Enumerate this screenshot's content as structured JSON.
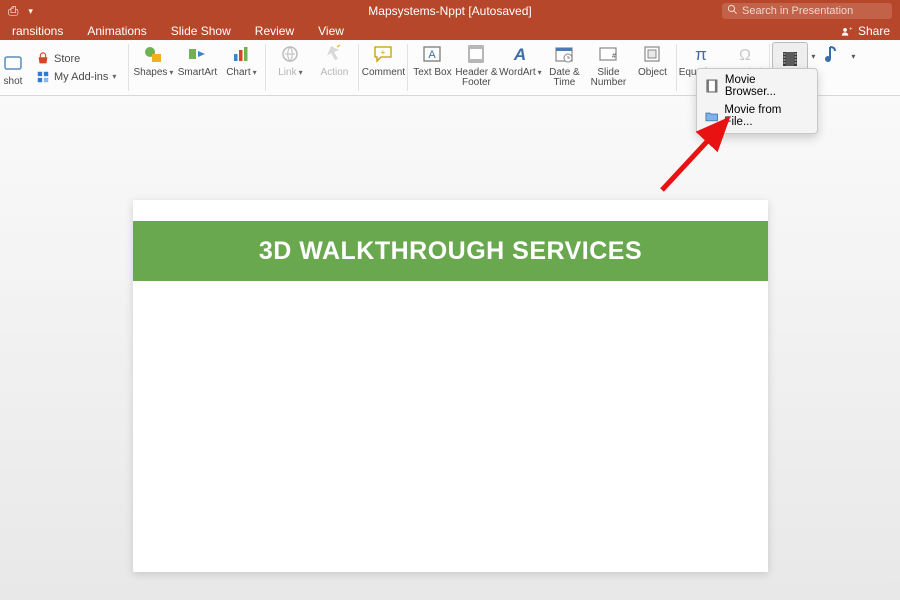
{
  "title": "Mapsystems-Nppt [Autosaved]",
  "search_placeholder": "Search in Presentation",
  "tabs": {
    "t0": "ransitions",
    "t1": "Animations",
    "t2": "Slide Show",
    "t3": "Review",
    "t4": "View"
  },
  "share": "Share",
  "store": {
    "store": "Store",
    "addins": "My Add-ins"
  },
  "ribbon": {
    "shot": "shot",
    "shapes": "Shapes",
    "smartart": "SmartArt",
    "chart": "Chart",
    "link": "Link",
    "action": "Action",
    "comment": "Comment",
    "textbox": "Text Box",
    "headerfooter": "Header & Footer",
    "wordart": "WordArt",
    "datetime": "Date & Time",
    "slidenum": "Slide Number",
    "object": "Object",
    "equation": "Equation",
    "symbol": "Symbol"
  },
  "menu": {
    "browser": "Movie Browser...",
    "file": "Movie from File..."
  },
  "slide": {
    "title": "3D WALKTHROUGH SERVICES"
  }
}
